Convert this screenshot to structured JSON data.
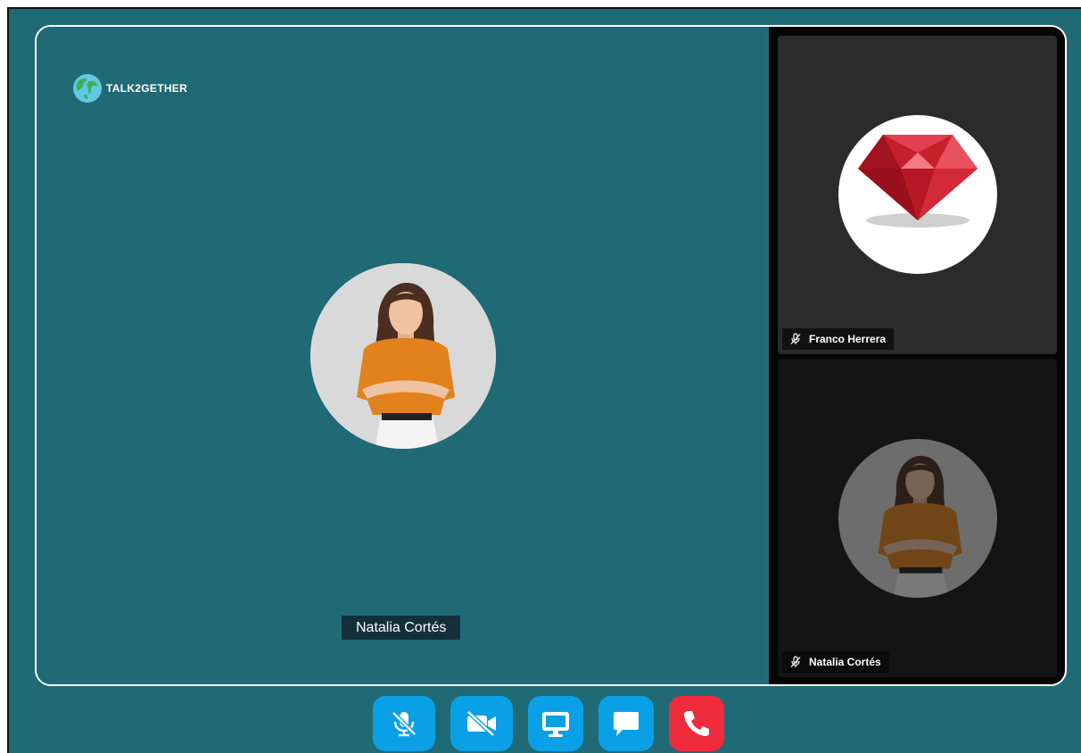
{
  "app": {
    "brand": "TALK2GETHER"
  },
  "main": {
    "speaker_name": "Natalia Cortés"
  },
  "participants": [
    {
      "name": "Franco Herrera",
      "muted": true,
      "avatar": "ruby-gem"
    },
    {
      "name": "Natalia Cortés",
      "muted": true,
      "avatar": "woman-portrait"
    }
  ],
  "controls": [
    {
      "id": "mute",
      "icon": "microphone-slash-icon"
    },
    {
      "id": "camera",
      "icon": "video-slash-icon"
    },
    {
      "id": "share-screen",
      "icon": "monitor-icon"
    },
    {
      "id": "chat",
      "icon": "chat-bubble-icon"
    },
    {
      "id": "hang-up",
      "icon": "phone-icon"
    }
  ],
  "colors": {
    "background": "#206a76",
    "sidebar": "#050505",
    "control_blue": "#0aa0e6",
    "hang_up_red": "#ee2c3c"
  }
}
